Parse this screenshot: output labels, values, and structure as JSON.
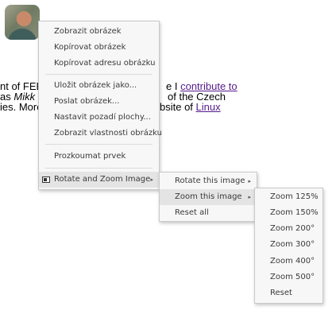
{
  "page": {
    "line1": {
      "prefix": "nt of FEE",
      "suffix": "e I",
      "link": "contribute to"
    },
    "line2": {
      "prefix": "as",
      "italic": "Mikk",
      "mid": "c",
      "suffix": "of the Czech"
    },
    "line3": {
      "prefix": "ies. More",
      "suffix": "bsite of",
      "link": "Linux"
    }
  },
  "context_menu": {
    "items": [
      "Zobrazit obrázek",
      "Kopírovat obrázek",
      "Kopírovat adresu obrázku",
      "Uložit obrázek jako...",
      "Poslat obrázek...",
      "Nastavit pozadí plochy...",
      "Zobrazit vlastnosti obrázku",
      "Prozkoumat prvek",
      "Rotate and Zoom Image"
    ],
    "extension_icon": "image-extension-icon",
    "submenu_arrow": "▸"
  },
  "rotate_zoom_menu": {
    "items": [
      "Rotate this image",
      "Zoom this image",
      "Reset all"
    ]
  },
  "zoom_menu": {
    "items": [
      "Zoom 125%",
      "Zoom 150%",
      "Zoom 200°",
      "Zoom 300°",
      "Zoom 400°",
      "Zoom 500°",
      "Reset"
    ]
  }
}
